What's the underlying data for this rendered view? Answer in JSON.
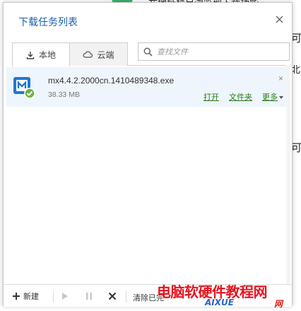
{
  "background": {
    "top_text": "在地址栏目浏览到下载功能",
    "side_text_1": "可",
    "side_text_2": "北",
    "side_text_3": "可"
  },
  "panel": {
    "title": "下载任务列表",
    "close_glyph": "✕"
  },
  "tabs": [
    {
      "label": "本地",
      "icon": "download-icon",
      "active": true
    },
    {
      "label": "云端",
      "icon": "cloud-icon",
      "active": false
    }
  ],
  "search": {
    "placeholder": "查找文件"
  },
  "downloads": [
    {
      "file_name": "mx4.4.2.2000cn.1410489348.exe",
      "file_size": "38.33 MB",
      "icon": "maxthon-installer-icon",
      "actions": {
        "open": "打开",
        "folder": "文件夹",
        "more": "更多"
      },
      "close_glyph": "×"
    }
  ],
  "toolbar": {
    "new_label": "新建",
    "clear_label": "清除已完",
    "buttons": [
      "play-icon",
      "pause-icon",
      "delete-icon"
    ]
  },
  "watermark": {
    "main": "电脑软硬件教程网",
    "sub": "AIXUE",
    "sub2": "网"
  },
  "colors": {
    "title_blue": "#1a5fa8",
    "link_green": "#2a7a1a",
    "row_highlight": "#eef5fc",
    "watermark_red": "#e8131f"
  }
}
